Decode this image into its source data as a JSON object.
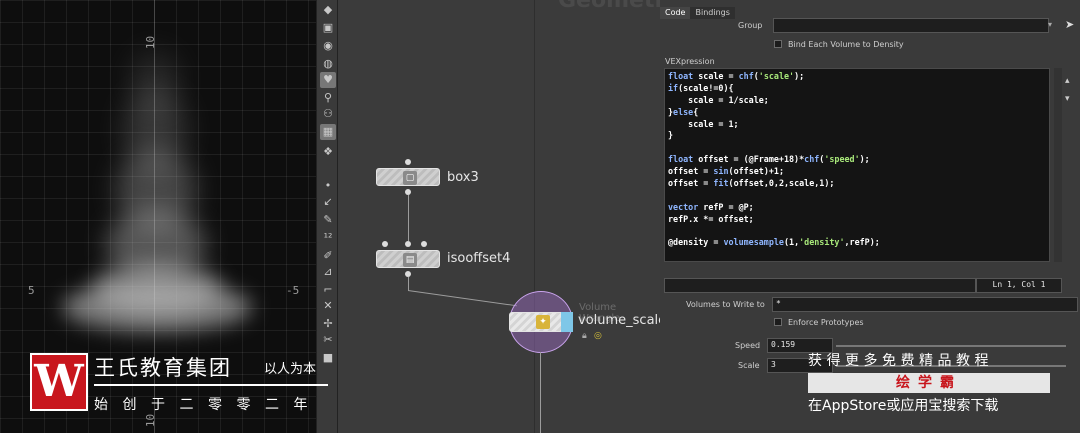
{
  "viewport": {
    "labels": {
      "top_tick": "10",
      "left_tick": "5",
      "right_tick": "-5",
      "bottom_tick": "10"
    }
  },
  "network": {
    "title": "Geometry",
    "nodes": [
      {
        "label": "box3"
      },
      {
        "label": "isooffset4"
      },
      {
        "label": "volume_scale",
        "type_label": "Volume Wrangle"
      }
    ]
  },
  "params": {
    "tabs": [
      "Code",
      "Bindings"
    ],
    "group_label": "Group",
    "group_value": "",
    "bind_volume_label": "Bind Each Volume to Density",
    "vexpression_label": "VEXpression",
    "code_lines": [
      "float scale = chf('scale');",
      "if(scale!=0){",
      "    scale = 1/scale;",
      "}else{",
      "    scale = 1;",
      "}",
      "",
      "float offset = (@Frame+18)*chf('speed');",
      "offset = sin(offset)+1;",
      "offset = fit(offset,0,2,scale,1);",
      "",
      "vector refP = @P;",
      "refP.x *= offset;",
      "",
      "@density = volumesample(1,'density',refP);"
    ],
    "cursor_pos": "Ln 1, Col 1",
    "volumes_write_label": "Volumes to Write to",
    "volumes_write_value": "*",
    "enforce_prototypes_label": "Enforce Prototypes",
    "speed_label": "Speed",
    "speed_value": "0.159",
    "scale_label": "Scale",
    "scale_value": "3"
  },
  "watermark": {
    "logo_letter": "W",
    "org_name": "王氏教育集团",
    "slogan": "以人为本",
    "founded": "始创于二零零二年",
    "promo_top": "获得更多免费精品教程",
    "promo_brand": "绘学霸",
    "promo_bottom": "在AppStore或应用宝搜索下载"
  }
}
